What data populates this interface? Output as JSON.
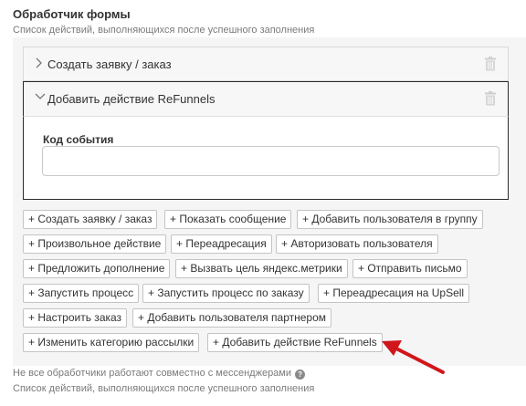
{
  "header": {
    "title": "Обработчик формы",
    "subtitle": "Список действий, выполняющихся после успешного заполнения"
  },
  "actions": [
    {
      "label": "Создать заявку / заказ",
      "state": "collapsed"
    },
    {
      "label": "Добавить действие ReFunnels",
      "state": "expanded"
    }
  ],
  "expanded_action": {
    "field_label": "Код события",
    "field_value": "",
    "field_placeholder": ""
  },
  "add_buttons": [
    "+ Создать заявку / заказ",
    "+ Показать сообщение",
    "+ Добавить пользователя в группу",
    "+ Произвольное действие",
    "+ Переадресация",
    "+ Авторизовать пользователя",
    "+ Предложить дополнение",
    "+ Вызвать цель яндекс.метрики",
    "+ Отправить письмо",
    "+ Запустить процесс",
    "+ Запустить процесс по заказу",
    "+ Переадресация на UpSell",
    "+ Настроить заказ",
    "+ Добавить пользователя партнером",
    "+ Изменить категорию рассылки",
    "+ Добавить действие ReFunnels"
  ],
  "footer": {
    "note": "Не все обработчики работают совместно с мессенджерами",
    "subtitle": "Список действий, выполняющихся после успешного заполнения"
  },
  "icons": {
    "trash": "trash-icon",
    "chevron_right": "chevron-right-icon",
    "chevron_down": "chevron-down-icon",
    "help": "help-icon",
    "annotation_arrow": "arrow-annotation"
  },
  "colors": {
    "arrow": "#d0161b",
    "panel_bg": "#f5f5f5",
    "border": "#c4c4c4"
  }
}
